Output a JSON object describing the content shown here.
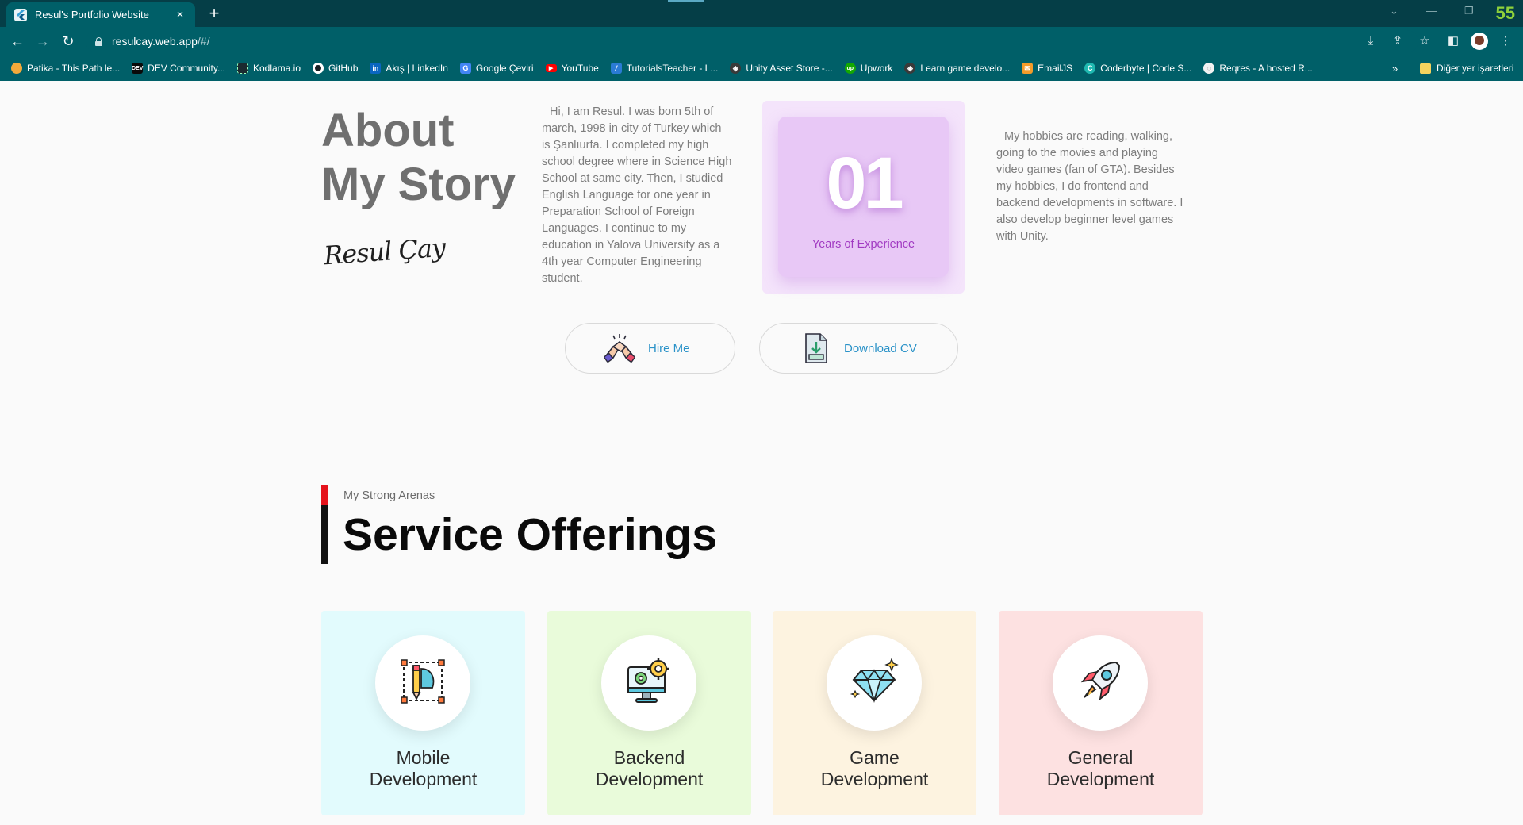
{
  "browser": {
    "tab_title": "Resul's Portfolio Website",
    "tab_close": "×",
    "new_tab": "+",
    "counter": "55",
    "url_host": "resulcay.web.app",
    "url_path": "/#/",
    "bookmarks": [
      {
        "label": "Patika - This Path le...",
        "icon_color": "#f2a93b",
        "icon": "patika-icon"
      },
      {
        "label": "DEV Community...",
        "icon_color": "#0a0a0a",
        "icon": "dev-icon"
      },
      {
        "label": "Kodlama.io",
        "icon_color": "#1b2a30",
        "icon": "kodlama-icon"
      },
      {
        "label": "GitHub",
        "icon_color": "#1b1f23",
        "icon": "github-icon"
      },
      {
        "label": "Akış | LinkedIn",
        "icon_color": "#0a66c2",
        "icon": "linkedin-icon"
      },
      {
        "label": "Google Çeviri",
        "icon_color": "#4285f4",
        "icon": "google-translate-icon"
      },
      {
        "label": "YouTube",
        "icon_color": "#ff0000",
        "icon": "youtube-icon"
      },
      {
        "label": "TutorialsTeacher - L...",
        "icon_color": "#2a7bd4",
        "icon": "tutorialsteacher-icon"
      },
      {
        "label": "Unity Asset Store -...",
        "icon_color": "#3a3a3a",
        "icon": "unity-icon"
      },
      {
        "label": "Upwork",
        "icon_color": "#14a800",
        "icon": "upwork-icon"
      },
      {
        "label": "Learn game develo...",
        "icon_color": "#3a3a3a",
        "icon": "unity-learn-icon"
      },
      {
        "label": "EmailJS",
        "icon_color": "#f49b2a",
        "icon": "emailjs-icon"
      },
      {
        "label": "Coderbyte | Code S...",
        "icon_color": "#1fb8b0",
        "icon": "coderbyte-icon"
      },
      {
        "label": "Reqres - A hosted R...",
        "icon_color": "#f2f2f2",
        "icon": "reqres-icon"
      }
    ],
    "bookmarks_more": "»",
    "other_bookmarks": "Diğer yer işaretleri"
  },
  "about": {
    "title_line1": "About",
    "title_line2": "My Story",
    "signature": "Resul Çay",
    "bio": "Hi, I am Resul. I was born  5th of march, 1998 in city of Turkey which is Şanlıurfa. I completed my high school degree where in Science High School at same city. Then, I studied English Language for one year in Preparation School of Foreign Languages. I continue to my education in Yalova University as a 4th year Computer Engineering student.",
    "experience_number": "01",
    "experience_label": "Years of Experience",
    "hobbies": "My hobbies are reading, walking, going to the movies and playing video games (fan of GTA). Besides my hobbies, I do frontend and backend developments in software. I also develop beginner level games with Unity.",
    "hire_label": "Hire Me",
    "cv_label": "Download CV"
  },
  "services": {
    "subtitle": "My Strong Arenas",
    "title": "Service Offerings",
    "cards": [
      {
        "line1": "Mobile",
        "line2": "Development",
        "bg": "#e2fbfd",
        "icon": "mobile-design-icon"
      },
      {
        "line1": "Backend",
        "line2": "Development",
        "bg": "#e9fbda",
        "icon": "backend-monitor-gear-icon"
      },
      {
        "line1": "Game",
        "line2": "Development",
        "bg": "#fdf3e0",
        "icon": "diamond-icon"
      },
      {
        "line1": "General",
        "line2": "Development",
        "bg": "#fde1e1",
        "icon": "rocket-icon"
      }
    ]
  }
}
